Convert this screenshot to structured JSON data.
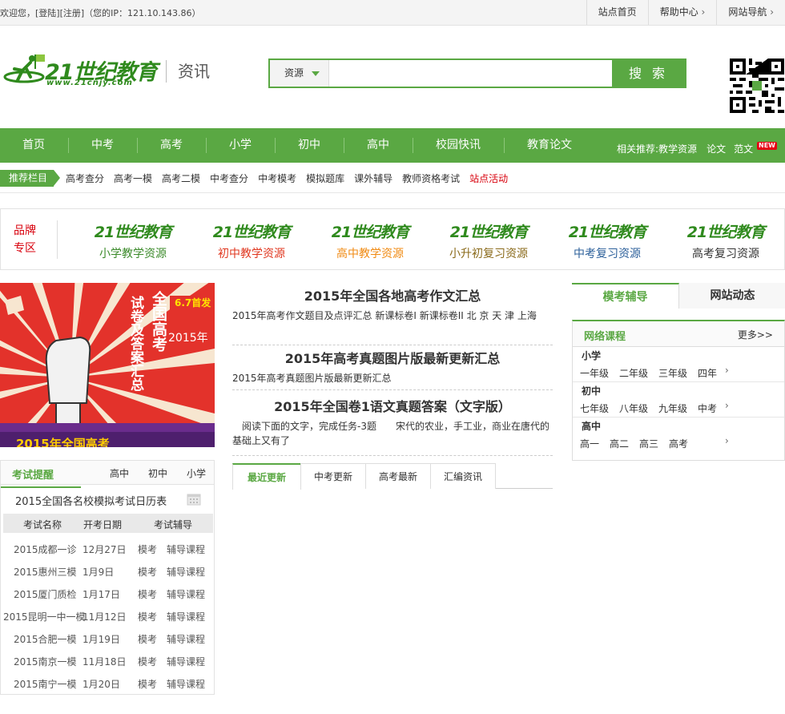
{
  "topbar": {
    "welcome": "欢迎您，[登陆][注册]（您的IP：121.10.143.86）",
    "links": [
      "站点首页",
      "帮助中心",
      "网站导航"
    ]
  },
  "header": {
    "logo_text": "21世纪教育",
    "logo_url": "www.21cnjy.com",
    "channel": "资讯",
    "search_select": "资源",
    "search_placeholder": "",
    "search_button": "搜 索"
  },
  "nav": {
    "items": [
      "首页",
      "中考",
      "高考",
      "小学",
      "初中",
      "高中",
      "校园快讯",
      "教育论文"
    ],
    "related_label": "相关推荐:",
    "related_links": [
      "教学资源",
      "论文",
      "范文"
    ],
    "new_badge": "NEW"
  },
  "recommend": {
    "tag": "推荐栏目",
    "links": [
      "高考查分",
      "高考一模",
      "高考二模",
      "中考查分",
      "中考模考",
      "模拟题库",
      "课外辅导",
      "教师资格考试",
      "站点活动"
    ]
  },
  "brand": {
    "label_1": "品牌",
    "label_2": "专区",
    "items": [
      {
        "logo": "21世纪教育",
        "sub": "小学教学资源",
        "color": "#3b8a2a"
      },
      {
        "logo": "21世纪教育",
        "sub": "初中教学资源",
        "color": "#e0371f"
      },
      {
        "logo": "21世纪教育",
        "sub": "高中教学资源",
        "color": "#f08a12"
      },
      {
        "logo": "21世纪教育",
        "sub": "小升初复习资源",
        "color": "#8a6a1a"
      },
      {
        "logo": "21世纪教育",
        "sub": "中考复习资源",
        "color": "#2b5f9a"
      },
      {
        "logo": "21世纪教育",
        "sub": "高考复习资源",
        "color": "#333333"
      }
    ]
  },
  "banner": {
    "date": "6.7首发",
    "title_1": "全国高考",
    "title_2": "试卷及答案汇总",
    "year": "2015年",
    "bottom": "2015年全国高考"
  },
  "exam": {
    "title": "考试提醒",
    "tabs": [
      "高中",
      "初中",
      "小学"
    ],
    "calendar_title": "2015全国各名校模拟考试日历表",
    "headers": [
      "考试名称",
      "开考日期",
      "考试辅导"
    ],
    "rows": [
      {
        "name": "2015成都一诊",
        "date": "12月27日",
        "a": "模考",
        "b": "辅导课程"
      },
      {
        "name": "2015惠州三模",
        "date": "1月9日",
        "a": "模考",
        "b": "辅导课程"
      },
      {
        "name": "2015厦门质检",
        "date": "1月17日",
        "a": "模考",
        "b": "辅导课程"
      },
      {
        "name": "2015昆明一中一模",
        "date": "11月12日",
        "a": "模考",
        "b": "辅导课程"
      },
      {
        "name": "2015合肥一模",
        "date": "1月19日",
        "a": "模考",
        "b": "辅导课程"
      },
      {
        "name": "2015南京一模",
        "date": "11月18日",
        "a": "模考",
        "b": "辅导课程"
      },
      {
        "name": "2015南宁一模",
        "date": "1月20日",
        "a": "模考",
        "b": "辅导课程"
      }
    ]
  },
  "news": [
    {
      "title": "2015年全国各地高考作文汇总",
      "desc": "2015年高考作文题目及点评汇总 新课标卷I 新课标卷II 北 京 天 津 上海"
    },
    {
      "title": "2015年高考真题图片版最新更新汇总",
      "desc": "2015年高考真题图片版最新更新汇总"
    },
    {
      "title": "2015年全国卷1语文真题答案（文字版）",
      "desc": "　阅读下面的文字，完成任务-3题　　宋代的农业，手工业，商业在唐代的基础上又有了"
    }
  ],
  "mid_tabs": [
    "最近更新",
    "中考更新",
    "高考最新",
    "汇编资讯"
  ],
  "right": {
    "tabs": [
      "模考辅导",
      "网站动态"
    ],
    "course_title": "网络课程",
    "more": "更多>>",
    "groups": [
      {
        "name": "小学",
        "items": [
          "一年级",
          "二年级",
          "三年级",
          "四年"
        ]
      },
      {
        "name": "初中",
        "items": [
          "七年级",
          "八年级",
          "九年级",
          "中考"
        ]
      },
      {
        "name": "高中",
        "items": [
          "高一",
          "高二",
          "高三",
          "高考"
        ]
      }
    ]
  },
  "colors": {
    "brand_green": "#5aa843",
    "hot_red": "#d8000c"
  }
}
